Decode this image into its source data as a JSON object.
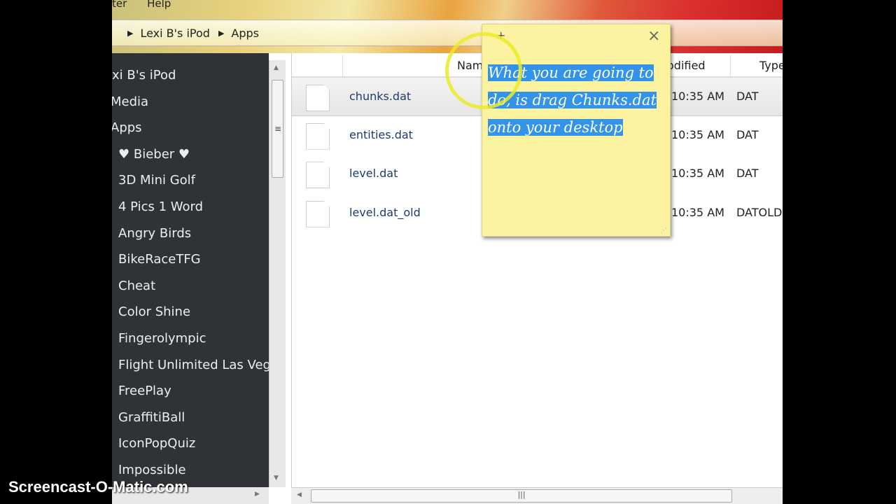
{
  "menu": [
    "ter",
    "Help"
  ],
  "breadcrumb": [
    "Lexi B's iPod",
    "Apps"
  ],
  "sidebar": [
    "xi B's iPod",
    "Media",
    "Apps",
    "♥ Bieber ♥",
    "3D Mini Golf",
    "4 Pics 1 Word",
    "Angry Birds",
    "BikeRaceTFG",
    "Cheat",
    "Color Shine",
    "Fingerolympic",
    "Flight Unlimited Las Vegas",
    "FreePlay",
    "GraffitiBall",
    "IconPopQuiz",
    "Impossible"
  ],
  "columns": {
    "name": "Name",
    "modified": "odified",
    "type": "Type"
  },
  "files": [
    {
      "name": "chunks.dat",
      "time": "10:35 AM",
      "type": "DAT",
      "selected": true
    },
    {
      "name": "entities.dat",
      "time": "10:35 AM",
      "type": "DAT"
    },
    {
      "name": "level.dat",
      "time": "10:35 AM",
      "type": "DAT"
    },
    {
      "name": "level.dat_old",
      "time": "10:35 AM",
      "type": "DATOLD"
    }
  ],
  "sticky": {
    "text": "What you are going to do, is drag Chunks.dat onto your desktop",
    "add": "+",
    "close": "×"
  },
  "watermark": "Screencast-O-Matic.com"
}
